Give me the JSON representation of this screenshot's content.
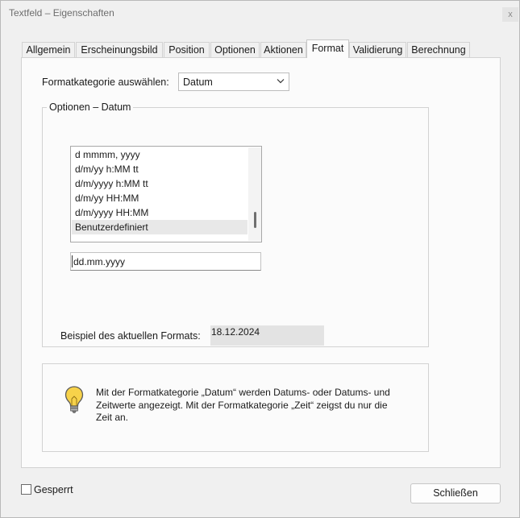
{
  "window": {
    "title": "Textfeld – Eigenschaften",
    "close_glyph": "x"
  },
  "tabs": [
    {
      "label": "Allgemein",
      "active": false
    },
    {
      "label": "Erscheinungsbild",
      "active": false
    },
    {
      "label": "Position",
      "active": false
    },
    {
      "label": "Optionen",
      "active": false
    },
    {
      "label": "Aktionen",
      "active": false
    },
    {
      "label": "Format",
      "active": true
    },
    {
      "label": "Validierung",
      "active": false
    },
    {
      "label": "Berechnung",
      "active": false
    }
  ],
  "format": {
    "category_label": "Formatkategorie auswählen:",
    "category_value": "Datum",
    "options_group_title": "Optionen – Datum",
    "date_formats": [
      "d mmmm, yyyy",
      "d/m/yy h:MM tt",
      "d/m/yyyy h:MM tt",
      "d/m/yy HH:MM",
      "d/m/yyyy HH:MM",
      "Benutzerdefiniert"
    ],
    "selected_format": "Benutzerdefiniert",
    "custom_format_value": "dd.mm.yyyy",
    "example_label": "Beispiel des aktuellen Formats:",
    "example_value": "18.12.2024"
  },
  "info": {
    "icon": "lightbulb-icon",
    "lines": [
      "Mit der Formatkategorie „Datum“ werden Datums- oder Datums- und",
      "Zeitwerte angezeigt. Mit der Formatkategorie „Zeit“ zeigst du nur die",
      "Zeit an."
    ]
  },
  "footer": {
    "locked_label": "Gesperrt",
    "locked_checked": false,
    "close_button_label": "Schließen"
  },
  "colors": {
    "window_bg": "#f0f0f0",
    "panel_bg": "#fbfbfb",
    "bulb_yellow": "#f7d24a"
  }
}
